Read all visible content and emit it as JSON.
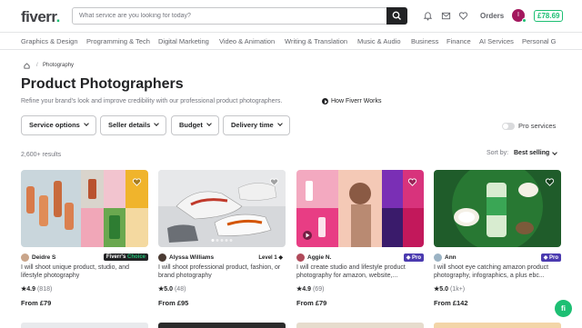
{
  "header": {
    "logo_text": "fiverr",
    "logo_dot": ".",
    "search_placeholder": "What service are you looking for today?",
    "orders_label": "Orders",
    "avatar_initial": "I",
    "balance": "£78.69"
  },
  "categories": [
    "Graphics & Design",
    "Programming & Tech",
    "Digital Marketing",
    "Video & Animation",
    "Writing & Translation",
    "Music & Audio",
    "Business",
    "Finance",
    "AI Services",
    "Personal G"
  ],
  "breadcrumb": {
    "sep": "/",
    "current": "Photography"
  },
  "page": {
    "title": "Product Photographers",
    "subtitle": "Refine your brand's look and improve credibility with our professional product photographers.",
    "how_it_works": "How Fiverr Works"
  },
  "filters": {
    "service_options": "Service options",
    "seller_details": "Seller details",
    "budget": "Budget",
    "delivery_time": "Delivery time",
    "pro_services": "Pro services"
  },
  "results": {
    "count": "2,600+ results",
    "sort_by": "Sort by:",
    "sort_value": "Best selling"
  },
  "gigs": [
    {
      "seller": "Deidre S",
      "badge": "Fiverr's Choice",
      "badge_prefix": "Fiverr's",
      "badge_suffix": "Choice",
      "title": "I will shoot unique product, studio, and lifestyle photography",
      "rating": "4.9",
      "reviews": "(818)",
      "price": "From £79"
    },
    {
      "seller": "Alyssa Williams",
      "badge": "Level 1 ◆",
      "title": "I will shoot professional product, fashion, or brand photography",
      "rating": "5.0",
      "reviews": "(48)",
      "price": "From £95"
    },
    {
      "seller": "Aggie N.",
      "badge": "◆ Pro",
      "title": "I will create studio and lifestyle product photography for amazon, website,...",
      "rating": "4.9",
      "reviews": "(69)",
      "price": "From £79"
    },
    {
      "seller": "Ann",
      "badge": "◆ Pro",
      "title": "I will shoot eye catching amazon product photography, infographics, a plus ebc...",
      "rating": "5.0",
      "reviews": "(1k+)",
      "price": "From £142"
    }
  ],
  "chat_label": "fi",
  "colors": {
    "brand": "#1dbf73",
    "pro": "#4b3bb0",
    "text": "#222325"
  }
}
